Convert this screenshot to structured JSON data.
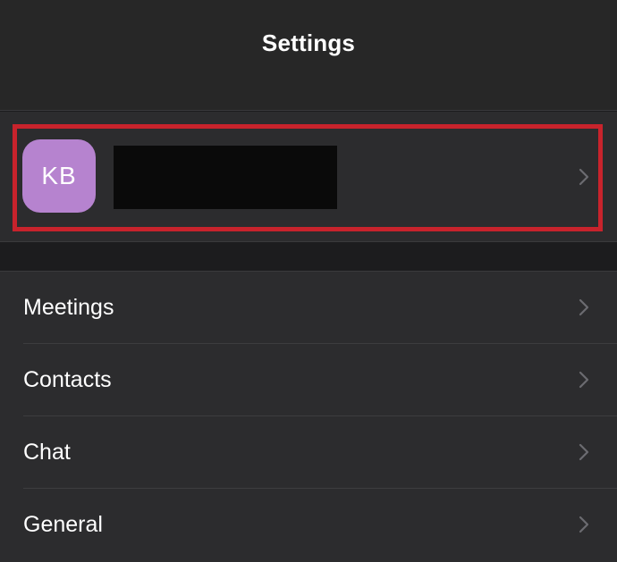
{
  "header": {
    "title": "Settings"
  },
  "profile": {
    "initials": "KB",
    "avatar_color": "#b683cf",
    "name": "",
    "highlight_color": "#c8232c"
  },
  "menu": {
    "items": [
      {
        "label": "Meetings"
      },
      {
        "label": "Contacts"
      },
      {
        "label": "Chat"
      },
      {
        "label": "General"
      }
    ]
  },
  "icons": {
    "row_chevron": "chevron-right-icon"
  },
  "colors": {
    "background": "#1c1c1e",
    "nav_background": "#272727",
    "cell_background": "#2c2c2e",
    "separator": "#3a3a3c",
    "chevron": "#6b6b70",
    "text": "#ffffff"
  }
}
